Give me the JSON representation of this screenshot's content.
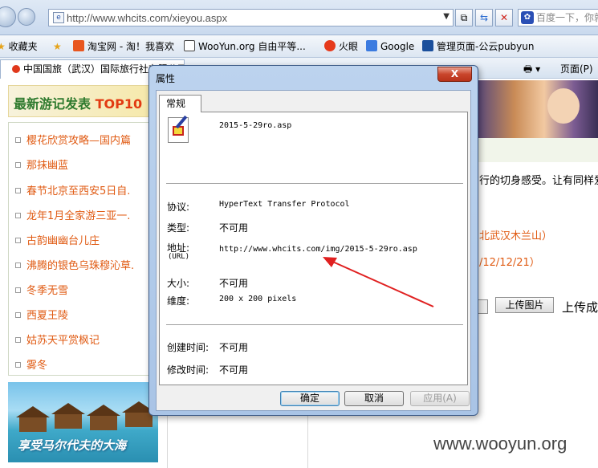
{
  "browser": {
    "url": "http://www.whcits.com/xieyou.aspx",
    "search_placeholder": "百度一下，你就知道",
    "favorites_label": "收藏夹",
    "favorites": [
      {
        "label": "淘宝网 - 淘！我喜欢",
        "icon": "taobao-icon",
        "color": "#e8561f"
      },
      {
        "label": "WooYun.org 自由平等...",
        "icon": "wooyun-icon",
        "color": "#3b3b3b"
      },
      {
        "label": "火眼",
        "icon": "huoyan-icon",
        "color": "#e63a1c"
      },
      {
        "label": "Google",
        "icon": "google-icon",
        "color": "#3b7be0"
      },
      {
        "label": "管理页面-公云pubyun",
        "icon": "pubyun-icon",
        "color": "#1b4f9c"
      }
    ],
    "tab_title": "中国国旅（武汉）国际旅行社有限公司",
    "page_menu": "页面(P)"
  },
  "page": {
    "banner_title_prefix": "最新游记发表",
    "banner_title_suffix": "TOP10",
    "articles": [
      "樱花欣赏攻略—国内篇",
      "那抹幽蓝",
      "春节北京至西安5日自.",
      "龙年1月全家游三亚一.",
      "古韵幽幽台儿庄",
      "沸腾的银色乌珠穆沁草.",
      "冬季无雪",
      "西夏王陵",
      "姑苏天平赏枫记",
      "雾冬"
    ],
    "travel_caption": "享受马尔代夫的大海",
    "right_text_1": "行的切身感受。让有同样爱",
    "right_text_2": "北武汉木兰山）",
    "right_text_3": "/12/12/21）",
    "upload_button": "上传图片",
    "upload_status": "上传成",
    "watermark": "www.wooyun.org"
  },
  "dialog": {
    "title": "属性",
    "close": "X",
    "tab": "常规",
    "file_name": "2015-5-29ro.asp",
    "protocol_label": "协议:",
    "protocol_value": "HyperText Transfer Protocol",
    "type_label": "类型:",
    "type_value": "不可用",
    "address_label": "地址:",
    "address_sub": "(URL)",
    "address_value": "http://www.whcits.com/img/2015-5-29ro.asp",
    "size_label": "大小:",
    "size_value": "不可用",
    "dimension_label": "维度:",
    "dimension_value": "200  x  200  pixels",
    "created_label": "创建时间:",
    "created_value": "不可用",
    "modified_label": "修改时间:",
    "modified_value": "不可用",
    "ok": "确定",
    "cancel": "取消",
    "apply": "应用(A)"
  },
  "colors": {
    "arrow": "#e02020",
    "link": "#e05a12"
  }
}
